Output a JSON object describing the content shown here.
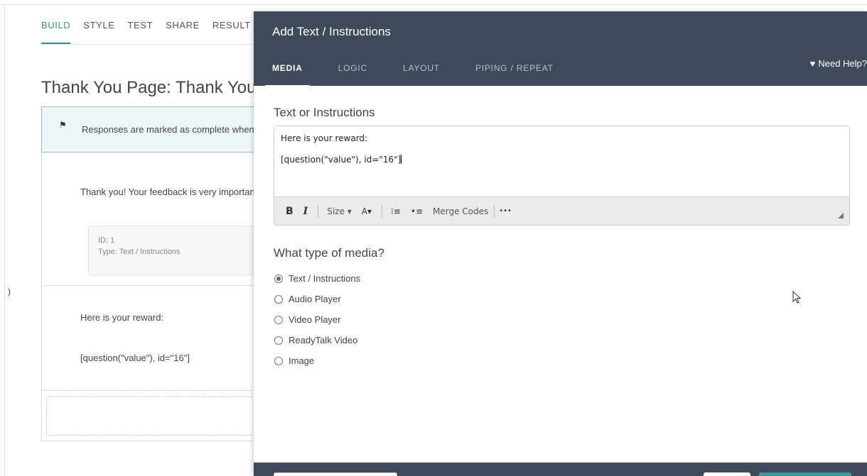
{
  "background": {
    "tabs": [
      "BUILD",
      "STYLE",
      "TEST",
      "SHARE",
      "RESULT"
    ],
    "active_tab": "BUILD",
    "page_title": "Thank You Page: Thank You!",
    "notice_text": "Responses are marked as complete when",
    "thanks_text": "Thank you! Your feedback is very important",
    "id_line": "ID: 1",
    "type_line": "Type: Text / Instructions",
    "reward_text": "Here is your reward:",
    "code_text": "[question(\"value\"), id=\"16\"]",
    "edge_glyph": ")"
  },
  "modal": {
    "title": "Add Text / Instructions",
    "tabs": [
      "MEDIA",
      "LOGIC",
      "LAYOUT",
      "PIPING / REPEAT"
    ],
    "active_tab": "MEDIA",
    "help_label": "Need Help?",
    "text_section_label": "Text or Instructions",
    "editor_line1": "Here is your reward:",
    "editor_line2": "[question(\"value\"), id=\"16\"]",
    "toolbar": {
      "bold": "B",
      "italic": "I",
      "size": "Size",
      "size_caret": "▾",
      "color": "A",
      "color_caret": "▾",
      "numbered_list": "⁝≡",
      "bulleted_list": "•≡",
      "merge_codes": "Merge Codes",
      "more": "•••"
    },
    "media_section_label": "What type of media?",
    "media_options": [
      "Text / Instructions",
      "Audio Player",
      "Video Player",
      "ReadyTalk Video",
      "Image"
    ],
    "selected_media": "Text / Instructions"
  },
  "colors": {
    "header_bg": "#3e4a59",
    "accent": "#3a8f96"
  }
}
